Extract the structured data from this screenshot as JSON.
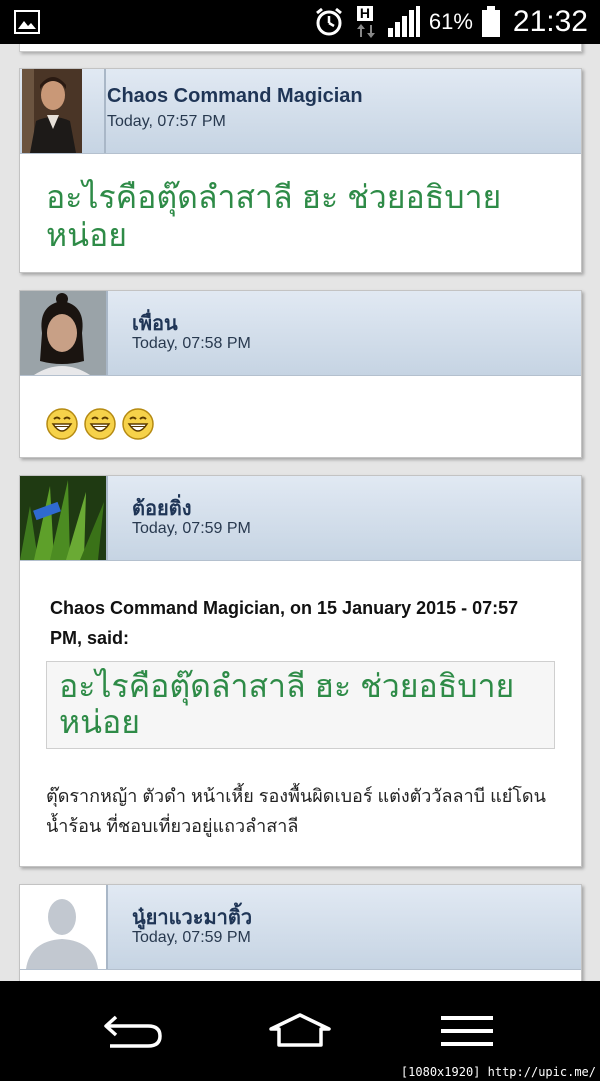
{
  "status_bar": {
    "battery_percent": "61%",
    "time": "21:32",
    "network_label": "H",
    "icons": [
      "gallery-icon",
      "alarm-icon",
      "network-h-icon",
      "signal-icon",
      "battery-icon"
    ]
  },
  "posts": [
    {
      "author": "Chaos Command Magician",
      "date": "Today, 07:57 PM",
      "body_text": "อะไรคือตุ๊ดลำสาลี ฮะ ช่วยอธิบายหน่อย"
    },
    {
      "author": "เพื่อน",
      "date": "Today, 07:58 PM",
      "emoticons": [
        "laugh-emoticon",
        "laugh-emoticon",
        "laugh-emoticon"
      ]
    },
    {
      "author": "ต้อยติ่ง",
      "date": "Today, 07:59 PM",
      "quote_citation": "Chaos Command Magician, on 15 January 2015 - 07:57 PM, said:",
      "quote_text": "อะไรคือตุ๊ดลำสาลี ฮะ ช่วยอธิบายหน่อย",
      "reply_text": "ตุ๊ดรากหญ้า ตัวดำ หน้าเหี้ย รองพื้นผิดเบอร์ แต่งตัววัลลาบี แย๋โดนน้ำร้อน ที่ชอบเที่ยวอยู่แถวลำสาลี"
    },
    {
      "author": "นู๋ยาแวะมาติ้ว",
      "date": "Today, 07:59 PM"
    }
  ],
  "colors": {
    "header_gradient_top": "#e1e9f3",
    "header_gradient_bottom": "#c6d4e3",
    "author_color": "#1f3556",
    "green_text": "#2e8b47"
  },
  "nav_bar": {
    "buttons": [
      "back-icon",
      "home-icon",
      "menu-icon"
    ]
  },
  "watermark": "[1080x1920] http://upic.me/"
}
